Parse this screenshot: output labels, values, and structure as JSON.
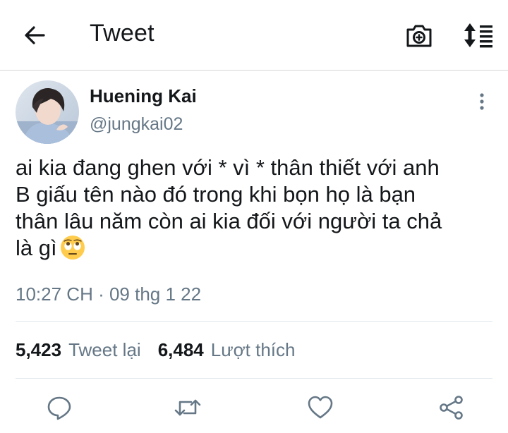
{
  "header": {
    "title": "Tweet",
    "back_icon": "arrow-left-icon",
    "camera_icon": "camera-plus-icon",
    "sort_icon": "sort-list-icon"
  },
  "tweet": {
    "author": {
      "display_name": "Huening Kai",
      "handle": "@jungkai02",
      "avatar_icon": "profile-photo"
    },
    "text": "ai kia đang ghen với * vì * thân thiết với anh\nB giấu tên nào đó trong khi bọn họ là bạn\nthân lâu năm còn ai kia đối với người ta chả\nlà gì",
    "emoji": "face-with-rolling-eyes",
    "timestamp": "10:27 CH · 09 thg 1 22"
  },
  "stats": {
    "retweets_count": "5,423",
    "retweets_label": "Tweet lại",
    "likes_count": "6,484",
    "likes_label": "Lượt thích"
  },
  "actions": [
    "reply-icon",
    "retweet-icon",
    "like-icon",
    "share-icon"
  ],
  "colors": {
    "text_primary": "#14171a",
    "text_secondary": "#657786",
    "icon": "#657786",
    "divider": "#e1e8ed"
  }
}
